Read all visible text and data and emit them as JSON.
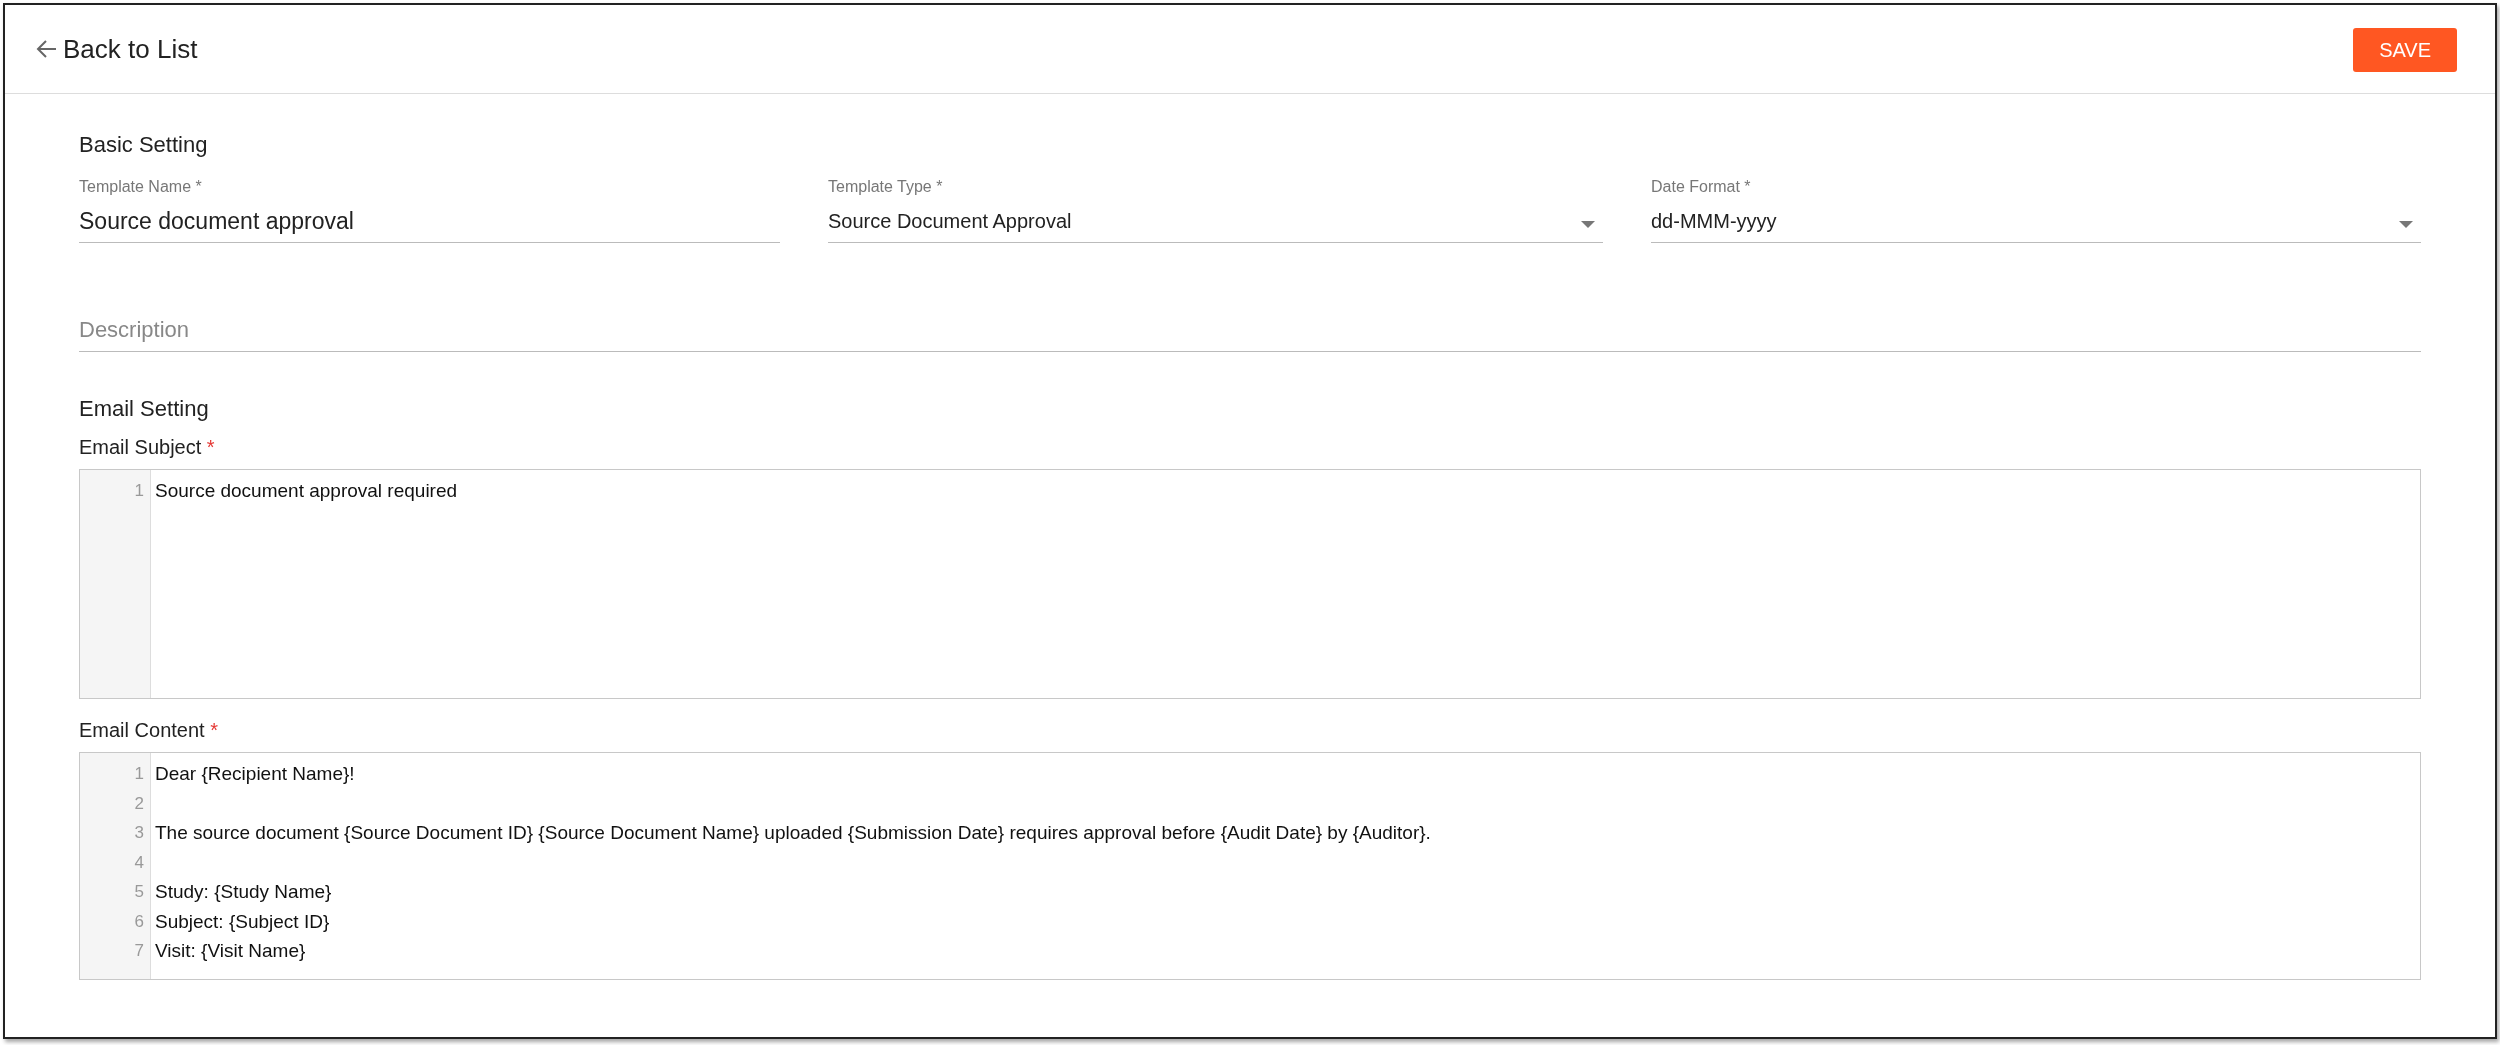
{
  "header": {
    "back_label": "Back to List",
    "save_label": "SAVE"
  },
  "basic_setting": {
    "title": "Basic Setting",
    "fields": [
      {
        "kind": "text",
        "label": "Template Name *",
        "value": "Source document approval"
      },
      {
        "kind": "select",
        "label": "Template Type *",
        "value": "Source Document Approval"
      },
      {
        "kind": "select",
        "label": "Date Format *",
        "value": "dd-MMM-yyyy"
      }
    ],
    "description": {
      "placeholder": "Description"
    }
  },
  "email_setting": {
    "title": "Email Setting",
    "editors": [
      {
        "label": "Email Subject",
        "required_mark": "*",
        "lines": [
          {
            "number": "1",
            "text": "Source document approval required"
          }
        ]
      },
      {
        "label": "Email Content",
        "required_mark": "*",
        "lines": [
          {
            "number": "1",
            "text": "Dear {Recipient Name}!"
          },
          {
            "number": "2"
          },
          {
            "number": "3",
            "text": "The source document {Source Document ID} {Source Document Name} uploaded {Submission Date} requires approval before {Audit Date} by {Auditor}."
          },
          {
            "number": "4"
          },
          {
            "number": "5",
            "text": "Study: {Study Name}"
          },
          {
            "number": "6",
            "text": "Subject: {Subject ID}"
          },
          {
            "number": "7",
            "text": "Visit: {Visit Name}"
          }
        ]
      }
    ]
  }
}
